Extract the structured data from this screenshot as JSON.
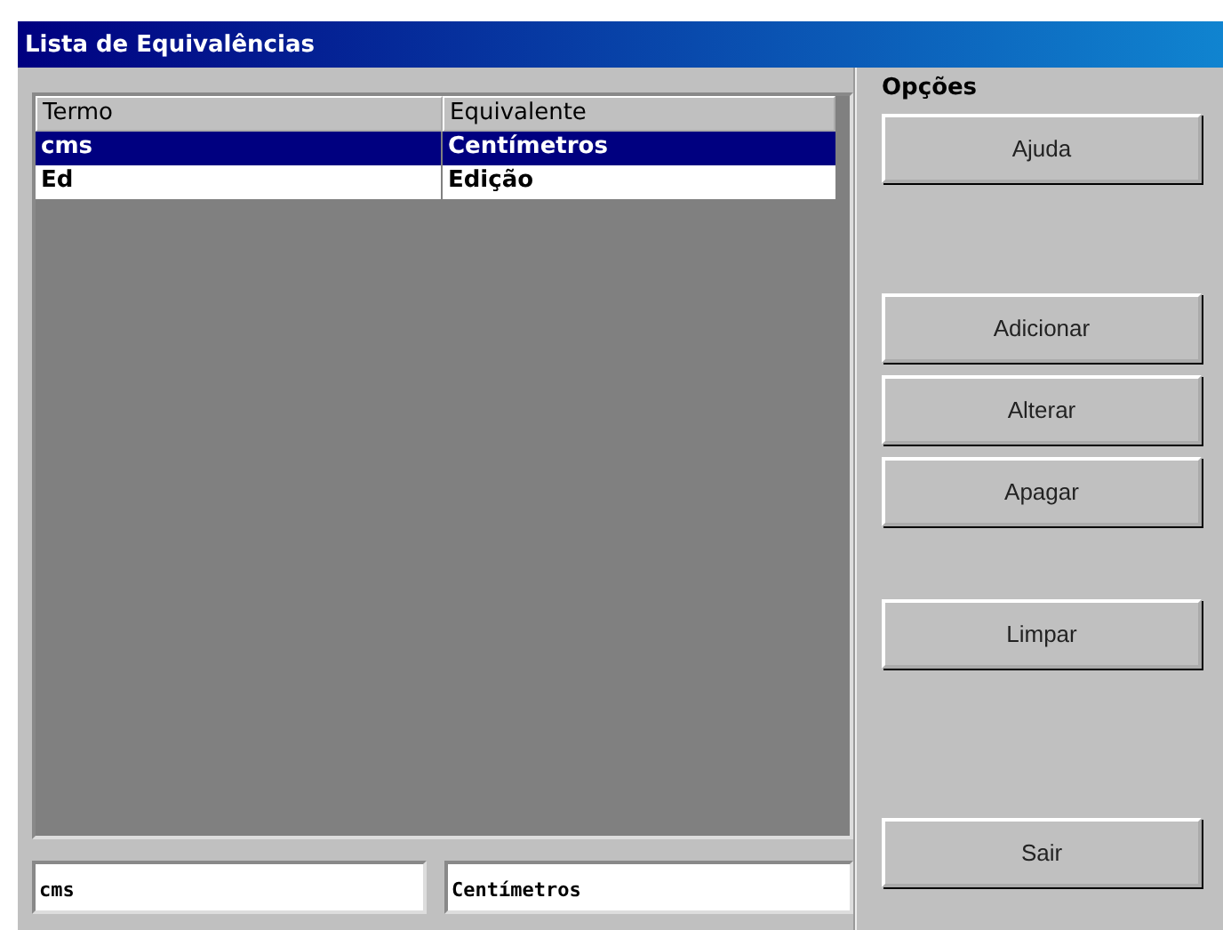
{
  "window": {
    "title": "Lista de Equivalências"
  },
  "table": {
    "columns": [
      "Termo",
      "Equivalente"
    ],
    "rows": [
      {
        "cells": [
          "cms",
          "Centímetros"
        ],
        "selected": true
      },
      {
        "cells": [
          "Ed",
          "Edição"
        ],
        "selected": false
      }
    ]
  },
  "fields": [
    {
      "value": "cms"
    },
    {
      "value": "Centímetros"
    }
  ],
  "options": {
    "title": "Opções",
    "buttons": [
      {
        "label": "Ajuda"
      },
      {
        "label": "Adicionar"
      },
      {
        "label": "Alterar"
      },
      {
        "label": "Apagar"
      },
      {
        "label": "Limpar"
      },
      {
        "label": "Sair"
      }
    ]
  }
}
